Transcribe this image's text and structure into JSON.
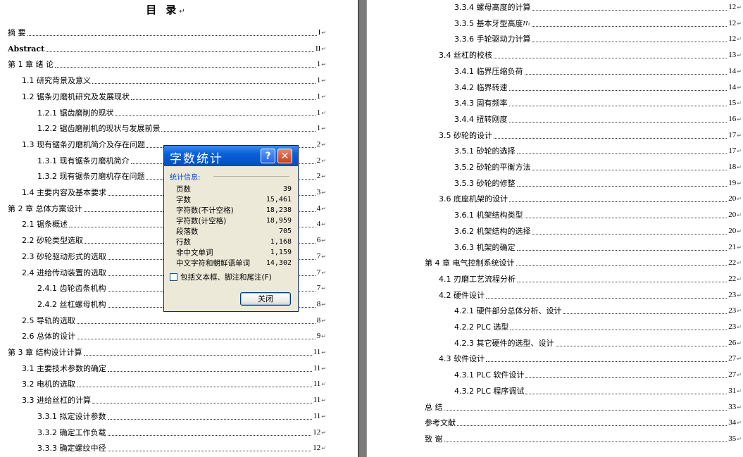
{
  "toc_title": "目 录",
  "left_entries": [
    {
      "text": "摘  要",
      "page": "I"
    },
    {
      "text": "Abstract",
      "page": "II"
    },
    {
      "text": "第 1 章  绪  论",
      "page": "1"
    },
    {
      "text": "1.1 研究背景及意义",
      "page": "1"
    },
    {
      "text": "1.2 锯条刃磨机研究及发展现状",
      "page": "1"
    },
    {
      "text": "1.2.1 锯齿磨削的现状",
      "page": "1"
    },
    {
      "text": "1.2.2 锯齿磨削机的现状与发展前景",
      "page": "1"
    },
    {
      "text": "1.3 现有锯条刃磨机简介及存在问题",
      "page": "2"
    },
    {
      "text": "1.3.1 现有锯条刃磨机简介",
      "page": "2"
    },
    {
      "text": "1.3.2 现有锯条刃磨机存在问题",
      "page": "2"
    },
    {
      "text": "1.4 主要内容及基本要求",
      "page": "3"
    },
    {
      "text": "第 2 章  总体方案设计",
      "page": "4"
    },
    {
      "text": "2.1 锯条概述",
      "page": "4"
    },
    {
      "text": "2.2 砂轮类型选取",
      "page": "6"
    },
    {
      "text": "2.3 砂轮驱动形式的选取",
      "page": "7"
    },
    {
      "text": "2.4 进给传动装置的选取",
      "page": "7"
    },
    {
      "text": "2.4.1 齿轮齿条机构",
      "page": "7"
    },
    {
      "text": "2.4.2 丝杠螺母机构",
      "page": "8"
    },
    {
      "text": "2.5 导轨的选取",
      "page": "8"
    },
    {
      "text": "2.6 总体的设计",
      "page": "9"
    },
    {
      "text": "第 3 章  结构设计计算",
      "page": "11"
    },
    {
      "text": "3.1 主要技术参数的确定",
      "page": "11"
    },
    {
      "text": "3.2 电机的选取",
      "page": "11"
    },
    {
      "text": "3.3 进给丝杠的计算",
      "page": "11"
    },
    {
      "text": "3.3.1 拟定设计参数",
      "page": "11"
    },
    {
      "text": "3.3.2 确定工作负载",
      "page": "12"
    },
    {
      "text": "3.3.3 确定螺纹中径",
      "page": "12"
    }
  ],
  "right_entries": [
    {
      "text": "3.3.4 螺母高度的计算",
      "page": "12"
    },
    {
      "text": "3.3.5 基本牙型高度",
      "page": "12",
      "sup": "H₁"
    },
    {
      "text": "3.3.6 手轮驱动力计算",
      "page": "12"
    },
    {
      "text": "3.4  丝杠的校核",
      "page": "13"
    },
    {
      "text": "3.4.1 临界压缩负荷",
      "page": "14"
    },
    {
      "text": "3.4.2 临界转速",
      "page": "14"
    },
    {
      "text": "3.4.3 固有频率",
      "page": "15"
    },
    {
      "text": "3.4.4 扭转刚度",
      "page": "16"
    },
    {
      "text": "3.5 砂轮的设计",
      "page": "17"
    },
    {
      "text": "3.5.1 砂轮的选择",
      "page": "17"
    },
    {
      "text": "3.5.2 砂轮的平衡方法",
      "page": "18"
    },
    {
      "text": "3.5.3 砂轮的修整",
      "page": "19"
    },
    {
      "text": "3.6 底座机架的设计",
      "page": "20"
    },
    {
      "text": "3.6.1 机架结构类型",
      "page": "20"
    },
    {
      "text": "3.6.2 机架结构的选择",
      "page": "20"
    },
    {
      "text": "3.6.3 机架的确定",
      "page": "21"
    },
    {
      "text": "第 4 章  电气控制系统设计",
      "page": "22"
    },
    {
      "text": "4.1 刃磨工艺流程分析",
      "page": "22"
    },
    {
      "text": "4.2 硬件设计",
      "page": "23"
    },
    {
      "text": "4.2.1 硬件部分总体分析、设计",
      "page": "23"
    },
    {
      "text": "4.2.2 PLC 选型",
      "page": "23"
    },
    {
      "text": "4.2.3 其它硬件的选型、设计",
      "page": "26"
    },
    {
      "text": "4.3 软件设计",
      "page": "27"
    },
    {
      "text": "4.3.1 PLC 软件设计",
      "page": "27"
    },
    {
      "text": "4.3.2 PLC 程序调试",
      "page": "31"
    },
    {
      "text": "总  结",
      "page": "33"
    },
    {
      "text": "参考文献",
      "page": "34"
    },
    {
      "text": "致  谢",
      "page": "35"
    }
  ],
  "dialog": {
    "title": "字数统计",
    "help_label": "?",
    "close_label": "✕",
    "section_label": "统计信息:",
    "stats": [
      {
        "label": "页数",
        "value": "39"
      },
      {
        "label": "字数",
        "value": "15,461"
      },
      {
        "label": "字符数(不计空格)",
        "value": "18,238"
      },
      {
        "label": "字符数(计空格)",
        "value": "18,959"
      },
      {
        "label": "段落数",
        "value": "705"
      },
      {
        "label": "行数",
        "value": "1,168"
      },
      {
        "label": "非中文单词",
        "value": "1,159"
      },
      {
        "label": "中文字符和朝鲜语单词",
        "value": "14,302"
      }
    ],
    "checkbox_label": "包括文本框、脚注和尾注(F)",
    "checkbox_checked": false,
    "close_button_label": "关闭"
  },
  "colors": {
    "titlebar": "#0a5fd8",
    "dialog_bg": "#ece9d8",
    "section_text": "#0046d5",
    "gutter": "#7a7a7a"
  }
}
